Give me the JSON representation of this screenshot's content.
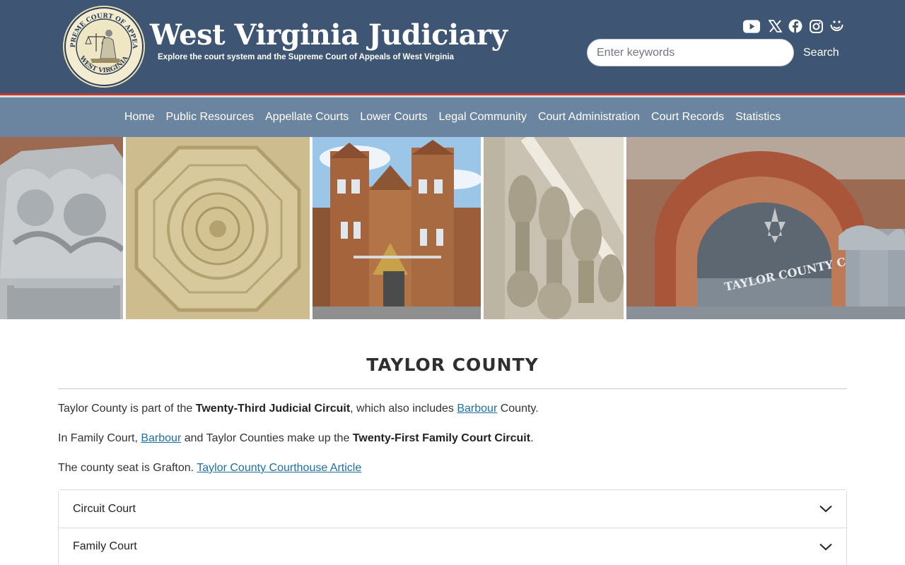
{
  "header": {
    "site_title": "West Virginia Judiciary",
    "tagline": "Explore the court system and the Supreme Court of Appeals of West Virginia",
    "seal_text_top": "SUPREME COURT OF APPEALS",
    "seal_text_bottom": "WEST VIRGINIA",
    "social_icons": [
      "youtube-icon",
      "x-icon",
      "facebook-icon",
      "instagram-icon",
      "threads-icon"
    ],
    "search": {
      "placeholder": "Enter keywords",
      "button_label": "Search"
    },
    "colors": {
      "header_bg": "#3e5673",
      "nav_bg": "#6b84a0",
      "accent_red": "#c0392b"
    }
  },
  "nav": {
    "items": [
      "Home",
      "Public Resources",
      "Appellate Courts",
      "Lower Courts",
      "Legal Community",
      "Court Administration",
      "Court Records",
      "Statistics"
    ]
  },
  "banner": {
    "courthouse_sign": "TAYLOR COUNTY COURT"
  },
  "page": {
    "title": "TAYLOR COUNTY",
    "p1": {
      "text1": "Taylor County is part of the ",
      "bold1": "Twenty-Third Judicial Circuit",
      "text2": ", which also includes ",
      "link1": "Barbour",
      "text3": " County."
    },
    "p2": {
      "text1": "In Family Court, ",
      "link1": "Barbour",
      "text2": " and Taylor Counties make up the ",
      "bold1": "Twenty-First Family Court Circuit",
      "text3": "."
    },
    "p3": {
      "text1": "The county seat is Grafton. ",
      "link1": "Taylor County Courthouse Article"
    },
    "accordion": [
      "Circuit Court",
      "Family Court"
    ],
    "colors": {
      "link": "#1d6fa5"
    }
  }
}
